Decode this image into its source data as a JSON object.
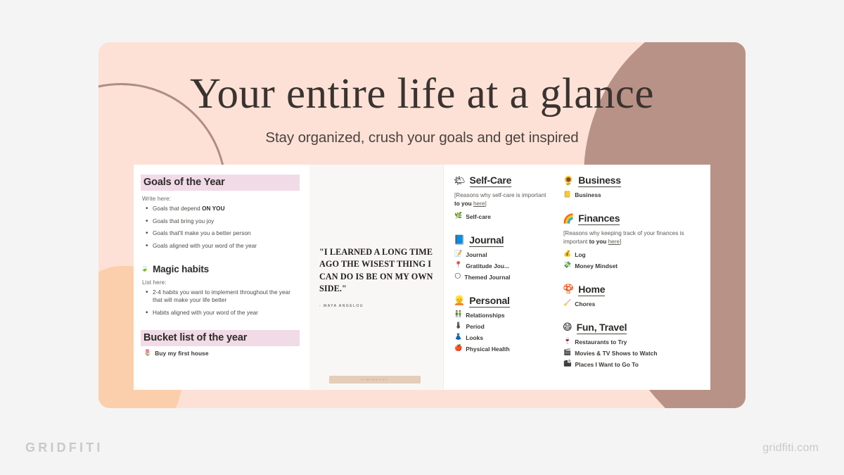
{
  "hero": {
    "title": "Your entire life at a glance",
    "subtitle": "Stay organized, crush your goals and get inspired"
  },
  "colors": {
    "card_bg": "#fde1d6",
    "blob_right": "#b99287",
    "blob_left": "#fbcfab",
    "arc_stroke": "#b08d82",
    "highlight_pink": "#f0dbe6",
    "quote_panel": "#f9f7f5",
    "page_bg": "#f4f4f4",
    "brand_gray": "#c9c9c9"
  },
  "notion": {
    "goals": {
      "heading": "Goals of the Year",
      "write_label": "Write here:",
      "bullets": [
        {
          "pre": "Goals that depend ",
          "bold": "ON YOU",
          "post": ""
        },
        {
          "pre": "Goals that bring you joy",
          "bold": "",
          "post": ""
        },
        {
          "pre": "Goals that'll make you a better person",
          "bold": "",
          "post": ""
        },
        {
          "pre": "Goals aligned with your word of the year",
          "bold": "",
          "post": ""
        }
      ],
      "habits": {
        "icon": "leaf-icon",
        "icon_glyph": "🍃",
        "heading": "Magic habits",
        "list_label": "List here:",
        "bullets": [
          "2-4 habits you want to implement throughout the year that will make your life better",
          "Habits aligned with your word of the year"
        ]
      },
      "bucket": {
        "heading": "Bucket list of the year",
        "items": [
          {
            "icon": "tulip-icon",
            "icon_glyph": "🌷",
            "label": "Buy my first house"
          }
        ]
      }
    },
    "quote": {
      "text": "\"I LEARNED A LONG TIME AGO THE WISEST THING I CAN DO IS BE ON MY OWN SIDE.\"",
      "attribution": "- MAYA ANGELOU",
      "watermark": "PINTEREST"
    },
    "mid_column": [
      {
        "icon": "sun-behind-cloud-icon",
        "icon_glyph": "🌤",
        "heading": "Self-Care",
        "note_parts": [
          {
            "text": "[Reasons why self-care is important ",
            "style": "normal"
          },
          {
            "text": "to you",
            "style": "bold"
          },
          {
            "text": " ",
            "style": "normal"
          },
          {
            "text": "here",
            "style": "underline"
          },
          {
            "text": "]",
            "style": "normal"
          }
        ],
        "items": [
          {
            "icon": "seedling-icon",
            "icon_glyph": "🌿",
            "label": "Self-care"
          }
        ]
      },
      {
        "icon": "notebook-icon",
        "icon_glyph": "📘",
        "heading": "Journal",
        "note_parts": [],
        "items": [
          {
            "icon": "memo-icon",
            "icon_glyph": "📝",
            "label": "Journal"
          },
          {
            "icon": "pin-icon",
            "icon_glyph": "📍",
            "label": "Gratitude Jou..."
          },
          {
            "icon": "crescent-moon-icon",
            "icon_glyph": "🌕",
            "label": "Themed Journal"
          }
        ]
      },
      {
        "icon": "person-icon",
        "icon_glyph": "👱",
        "heading": "Personal",
        "note_parts": [],
        "items": [
          {
            "icon": "people-icon",
            "icon_glyph": "👬",
            "label": "Relationships"
          },
          {
            "icon": "thermometer-icon",
            "icon_glyph": "🌡",
            "label": "Period"
          },
          {
            "icon": "dress-icon",
            "icon_glyph": "👗",
            "label": "Looks"
          },
          {
            "icon": "apple-icon",
            "icon_glyph": "🍎",
            "label": "Physical Health"
          }
        ]
      }
    ],
    "right_column": [
      {
        "icon": "sunflower-icon",
        "icon_glyph": "🌻",
        "heading": "Business",
        "note_parts": [],
        "items": [
          {
            "icon": "books-icon",
            "icon_glyph": "📒",
            "label": "Business"
          }
        ]
      },
      {
        "icon": "rainbow-icon",
        "icon_glyph": "🌈",
        "heading": "Finances",
        "note_parts": [
          {
            "text": "[Reasons why keeping track of your finances is important ",
            "style": "normal"
          },
          {
            "text": "to you",
            "style": "bold"
          },
          {
            "text": " ",
            "style": "normal"
          },
          {
            "text": "here",
            "style": "underline"
          },
          {
            "text": "]",
            "style": "normal"
          }
        ],
        "items": [
          {
            "icon": "money-bag-icon",
            "icon_glyph": "💰",
            "label": "Log"
          },
          {
            "icon": "money-wings-icon",
            "icon_glyph": "💸",
            "label": "Money Mindset"
          }
        ]
      },
      {
        "icon": "mushroom-icon",
        "icon_glyph": "🍄",
        "heading": "Home",
        "note_parts": [],
        "items": [
          {
            "icon": "broom-icon",
            "icon_glyph": "🧹",
            "label": "Chores"
          }
        ]
      },
      {
        "icon": "grinning-face-icon",
        "icon_glyph": "😄",
        "heading": "Fun, Travel",
        "note_parts": [],
        "items": [
          {
            "icon": "wine-glass-icon",
            "icon_glyph": "🍷",
            "label": "Restaurants to Try"
          },
          {
            "icon": "clapper-board-icon",
            "icon_glyph": "🎬",
            "label": "Movies & TV Shows to Watch"
          },
          {
            "icon": "cityscape-icon",
            "icon_glyph": "🏙",
            "label": "Places I Want to Go To"
          }
        ]
      }
    ]
  },
  "branding": {
    "left": "GRIDFITI",
    "right": "gridfiti.com"
  }
}
